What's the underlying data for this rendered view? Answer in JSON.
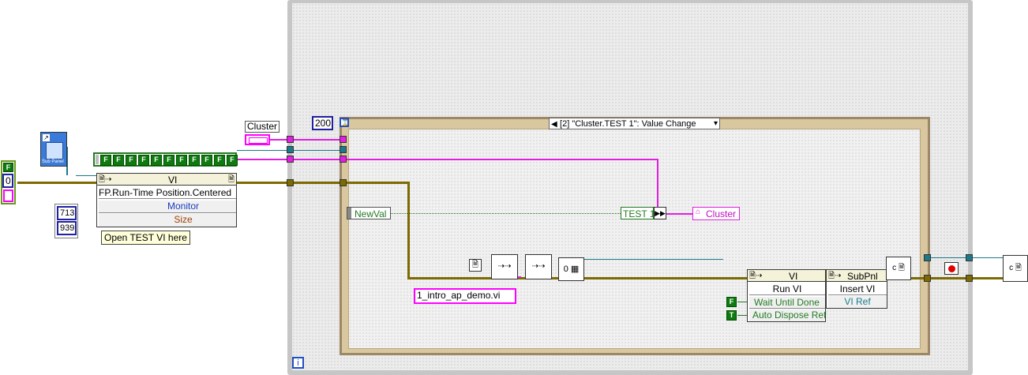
{
  "left_cluster": {
    "f_label": "F",
    "zero_value": "0"
  },
  "subpanel_ref": {
    "icon_text": "Sub Panel"
  },
  "bool_array": {
    "values": [
      "F",
      "F",
      "F",
      "F",
      "F",
      "F",
      "F",
      "F",
      "F",
      "F",
      "F"
    ]
  },
  "cluster_label": "Cluster",
  "vi_node": {
    "title": "VI",
    "property": "FP.Run-Time Position.Centered",
    "item1": "Monitor",
    "item2": "Size"
  },
  "size_constants": [
    "713",
    "939"
  ],
  "comment": "Open TEST VI here",
  "timeout_constant": "200",
  "event_case": "[2] \"Cluster.TEST 1\": Value Change",
  "newval_label": "NewVal",
  "test1_label": "TEST 1",
  "cluster_local": "Cluster",
  "vi_path_constant": "1_intro_ap_demo.vi",
  "run_vi_node": {
    "title": "VI",
    "method": "Run VI",
    "param1": "Wait Until Done",
    "param2": "Auto Dispose Ref"
  },
  "subpanel_node": {
    "title": "SubPnl",
    "method": "Insert VI",
    "param1": "VI Ref"
  },
  "bool_consts": {
    "wait_until_done": "F",
    "auto_dispose": "T"
  },
  "loop_iteration": "i",
  "colors": {
    "orange_wire": "#7d6a00",
    "pink_wire": "#e11ee1",
    "teal_wire": "#1a7a8a",
    "green_wire": "#247a24"
  }
}
